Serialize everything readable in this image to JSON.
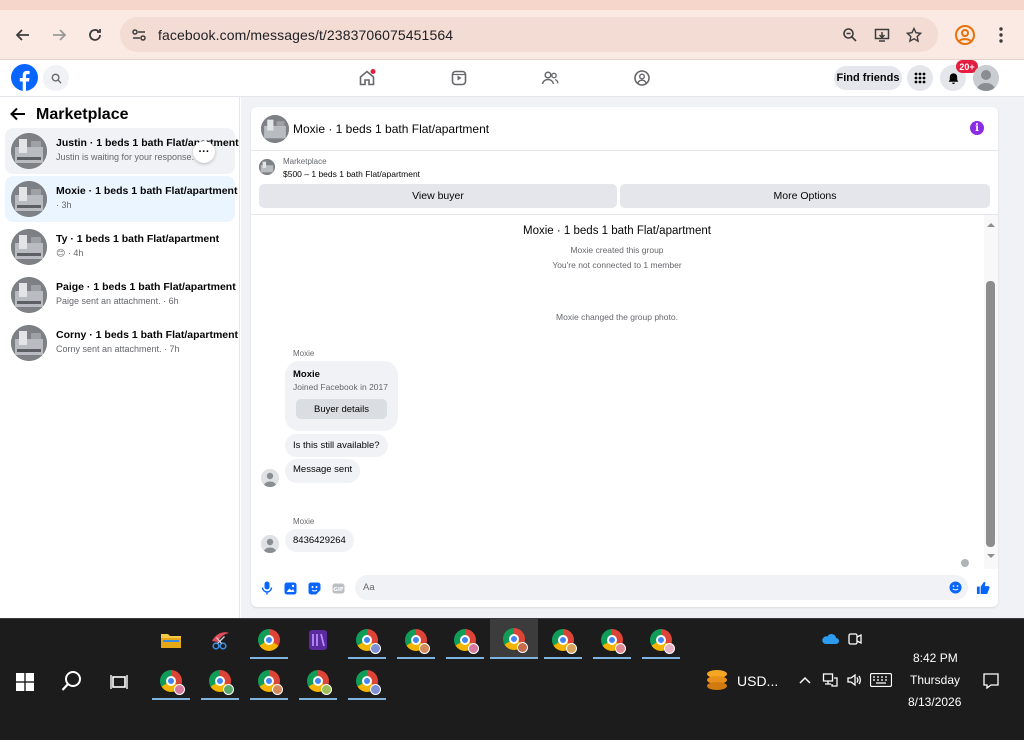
{
  "browser": {
    "url": "facebook.com/messages/t/2383706075451564"
  },
  "fb_header": {
    "find_friends_label": "Find friends",
    "notification_count": "20+"
  },
  "sidebar": {
    "title": "Marketplace",
    "conversations": [
      {
        "title": "Justin · 1 beds 1 bath Flat/apartment",
        "subtitle": "Justin is waiting for your response. · 1"
      },
      {
        "title": "Moxie · 1 beds 1 bath Flat/apartment",
        "subtitle": "· 3h"
      },
      {
        "title": "Ty · 1 beds 1 bath Flat/apartment",
        "subtitle": "😊 · 4h"
      },
      {
        "title": "Paige · 1 beds 1 bath Flat/apartment",
        "subtitle": "Paige sent an attachment. · 6h"
      },
      {
        "title": "Corny · 1 beds 1 bath Flat/apartment",
        "subtitle": "Corny sent an attachment. · 7h"
      }
    ],
    "more_label": "···"
  },
  "chat": {
    "header_name": "Moxie · 1 beds 1 bath Flat/apartment",
    "info_label": "i",
    "listing": {
      "label": "Marketplace",
      "price_line": "$500 – 1 beds 1 bath Flat/apartment",
      "view_buyer": "View buyer",
      "more_options": "More Options"
    },
    "group_name": "Moxie · 1 beds 1 bath Flat/apartment",
    "created_note": "Moxie created this group",
    "connected_note": "You're not connected to 1 member",
    "photo_note": "Moxie changed the group photo.",
    "sender_1": "Moxie",
    "buyer_card": {
      "name": "Moxie",
      "joined": "Joined Facebook in 2017",
      "button": "Buyer details"
    },
    "msg_available": "Is this still available?",
    "msg_sent": "Message sent",
    "sender_2": "Moxie",
    "msg_phone": "8436429264",
    "composer_placeholder": "Aa"
  },
  "taskbar": {
    "tray_label": "USD...",
    "time": "8:42 PM",
    "day": "Thursday",
    "date": "8/13/2026"
  },
  "colors": {
    "fb_blue": "#0866ff",
    "chrome_bg": "#fbe9e3",
    "taskbar_bg": "#1c1c1c",
    "notification_red": "#e41e3f",
    "info_purple": "#8b2be2"
  }
}
